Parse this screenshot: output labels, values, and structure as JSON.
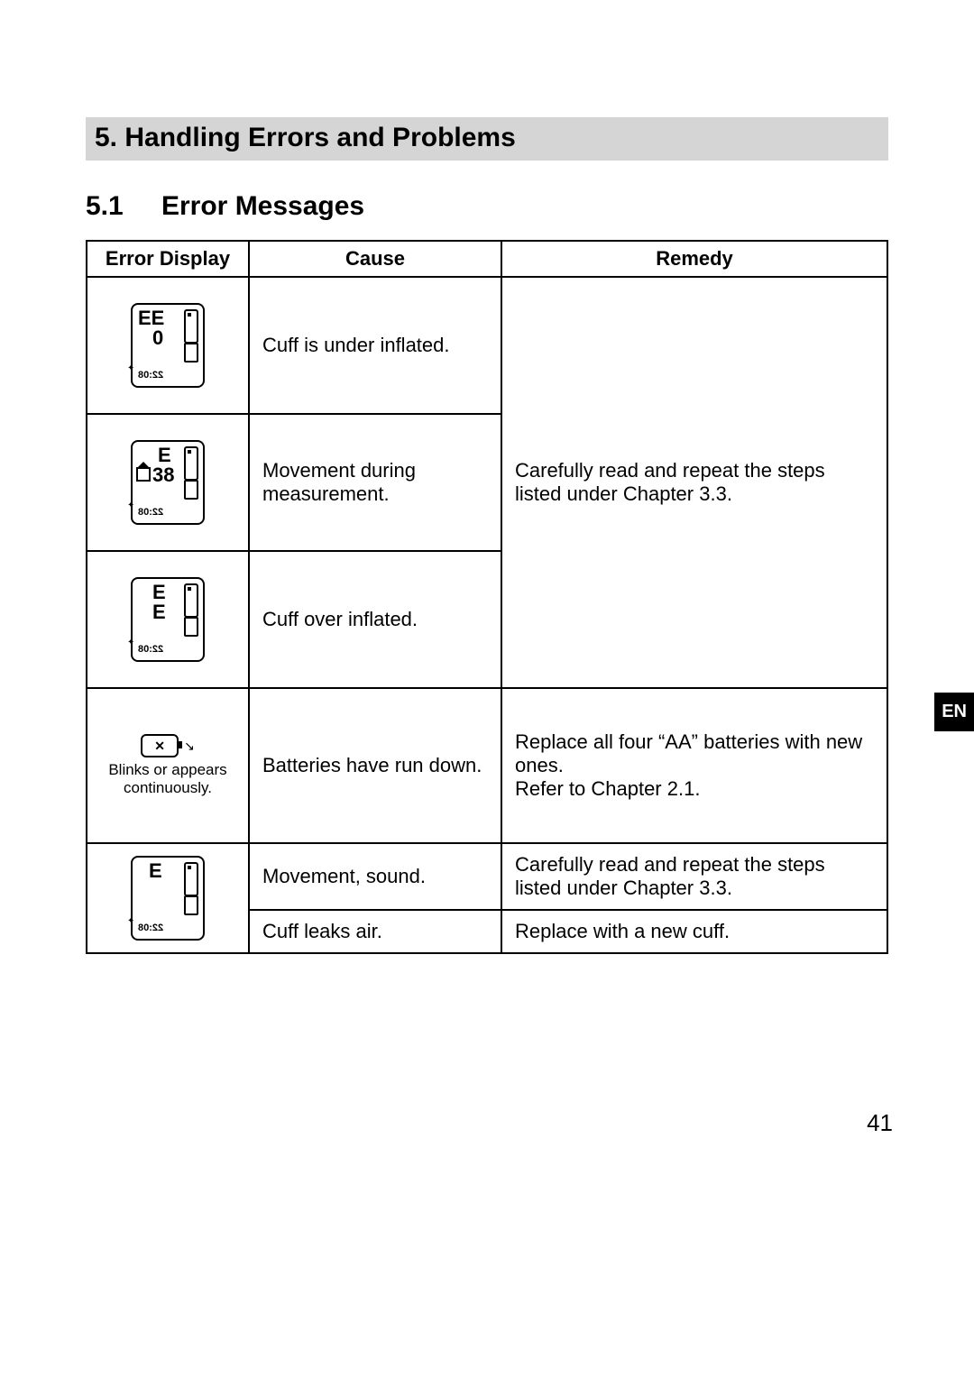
{
  "chapter_title": "5.  Handling Errors and Problems",
  "section_number": "5.1",
  "section_title": "Error Messages",
  "language_tab": "EN",
  "page_number": "41",
  "table": {
    "headers": {
      "display": "Error Display",
      "cause": "Cause",
      "remedy": "Remedy"
    },
    "remedy_group1": "Carefully read and repeat the steps listed under Chapter 3.3.",
    "rows": {
      "r1": {
        "lcd_big": "EE",
        "lcd_mid": "0",
        "lcd_date": "22:08",
        "cause": "Cuff is under inflated."
      },
      "r2": {
        "lcd_big": "E",
        "lcd_mid": "38",
        "lcd_date": "22:08",
        "cause": "Movement during measurement."
      },
      "r3": {
        "lcd_big": "E",
        "lcd_mid": "E",
        "lcd_date": "22:08",
        "cause": "Cuff over inflated."
      },
      "r4": {
        "caption": "Blinks or appears continuously.",
        "batt_symbol": "✕",
        "cause": "Batteries have run down.",
        "remedy_line1": "Replace all four “AA” batteries with new ones.",
        "remedy_line2": "Refer to Chapter 2.1."
      },
      "r5": {
        "lcd_big": "E",
        "lcd_date": "22:08",
        "cause_a": "Movement, sound.",
        "remedy_a": "Carefully read and repeat the steps listed under Chapter 3.3.",
        "cause_b": "Cuff leaks air.",
        "remedy_b": "Replace with a new cuff."
      }
    }
  }
}
